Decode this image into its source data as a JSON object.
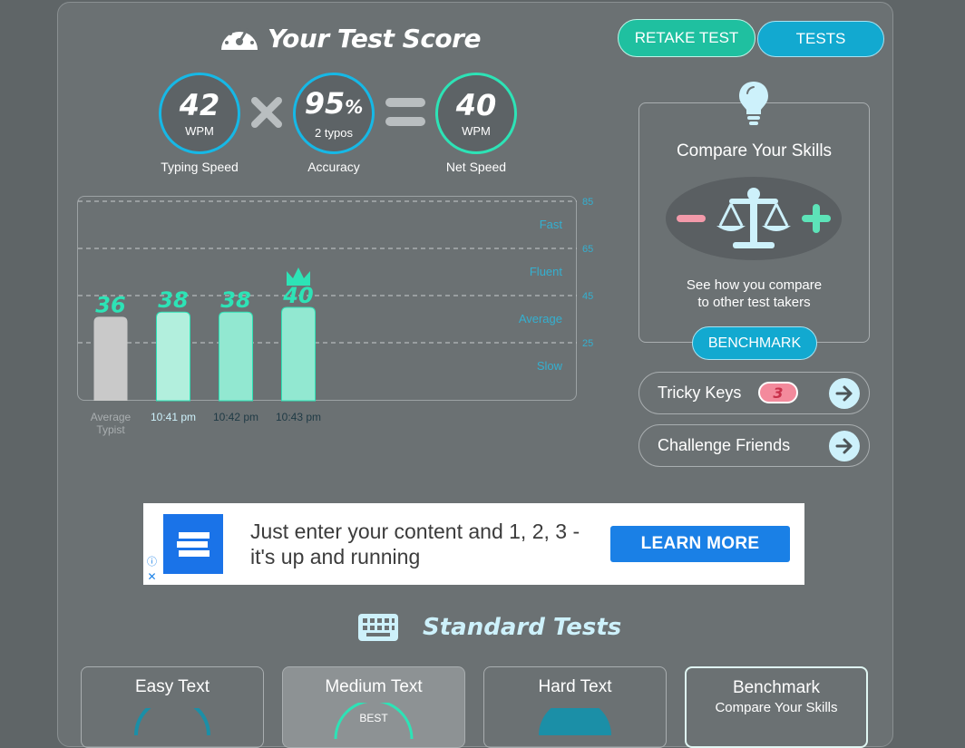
{
  "header": {
    "title": "Your Test Score",
    "retake_label": "RETAKE TEST",
    "tests_label": "TESTS"
  },
  "stats": {
    "speed": {
      "value": "42",
      "unit": "WPM",
      "label": "Typing Speed"
    },
    "accuracy": {
      "value": "95",
      "pct": "%",
      "unit": "2  typos",
      "label": "Accuracy"
    },
    "net": {
      "value": "40",
      "unit": "WPM",
      "label": "Net Speed"
    }
  },
  "chart_data": {
    "type": "bar",
    "categories": [
      "Average Typist",
      "10:41 pm",
      "10:42 pm",
      "10:43 pm"
    ],
    "values": [
      36,
      38,
      38,
      40
    ],
    "ylim": [
      0,
      85
    ],
    "y_ticks": [
      25,
      45,
      65,
      85
    ],
    "bands": [
      "Slow",
      "Average",
      "Fluent",
      "Fast"
    ],
    "grid": "dashed horizontal",
    "colors": [
      "#c9c9c9",
      "#b2efdd",
      "#92e8d1",
      "#92e8d1"
    ],
    "best_marker_index": 3
  },
  "compare": {
    "title": "Compare Your Skills",
    "text_line1": "See how you compare",
    "text_line2": "to other test takers",
    "button": "BENCHMARK"
  },
  "tricky": {
    "label": "Tricky Keys",
    "count": "3"
  },
  "challenge": {
    "label": "Challenge Friends"
  },
  "ad": {
    "text": "Just enter your content and 1, 2, 3 - it's up and running",
    "button": "LEARN MORE",
    "info": "ⓘ",
    "close": "✕"
  },
  "standard": {
    "title": "Standard Tests",
    "cards": [
      {
        "title": "Easy Text"
      },
      {
        "title": "Medium Text",
        "badge": "BEST"
      },
      {
        "title": "Hard Text"
      },
      {
        "title": "Benchmark",
        "sub": "Compare Your Skills"
      }
    ]
  },
  "colors": {
    "accent_blue": "#16b8e6",
    "accent_green": "#2de3b6",
    "retake_bg": "#1fc0a0",
    "tests_bg": "#12a9d0",
    "badge_pink": "#f38a9c"
  }
}
